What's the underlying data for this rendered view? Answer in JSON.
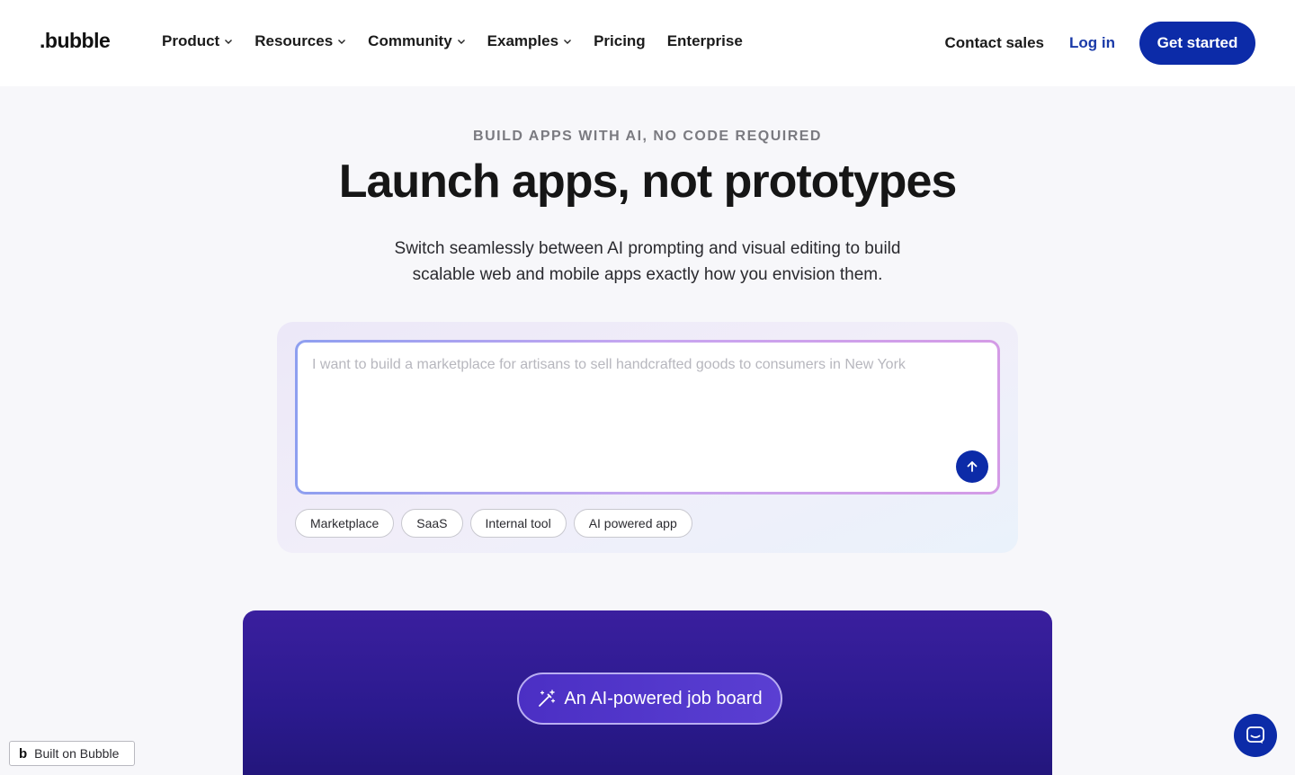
{
  "header": {
    "logo": ".bubble",
    "nav": [
      {
        "label": "Product",
        "dropdown": true
      },
      {
        "label": "Resources",
        "dropdown": true
      },
      {
        "label": "Community",
        "dropdown": true
      },
      {
        "label": "Examples",
        "dropdown": true
      },
      {
        "label": "Pricing",
        "dropdown": false
      },
      {
        "label": "Enterprise",
        "dropdown": false
      }
    ],
    "contact_sales": "Contact sales",
    "log_in": "Log in",
    "get_started": "Get started"
  },
  "hero": {
    "eyebrow": "BUILD APPS WITH AI, NO CODE REQUIRED",
    "title": "Launch apps, not prototypes",
    "subtitle_line1": "Switch seamlessly between AI prompting and visual editing to build",
    "subtitle_line2": "scalable web and mobile apps exactly how you envision them."
  },
  "prompt": {
    "placeholder": "I want to build a marketplace for artisans to sell handcrafted goods to consumers in New York",
    "value": "",
    "send_icon": "arrow-up-icon",
    "chips": [
      "Marketplace",
      "SaaS",
      "Internal tool",
      "AI powered app"
    ]
  },
  "demo": {
    "pill_icon": "magic-wand-icon",
    "pill_label": "An AI-powered job board"
  },
  "badge": {
    "logo": "b",
    "label": "Built on Bubble"
  },
  "chat": {
    "icon": "chat-icon"
  },
  "colors": {
    "brand": "#0c2ba8",
    "link": "#1a3aa8",
    "demo_bg": "#2b1a8e"
  }
}
